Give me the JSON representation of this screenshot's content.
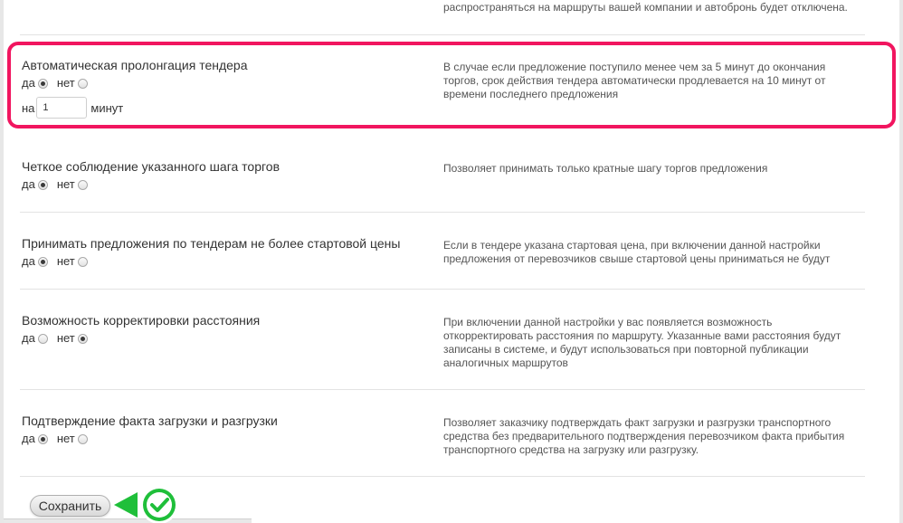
{
  "top_note": "распространяться на маршруты вашей компании и автобронь будет отключена.",
  "radio_labels": {
    "yes": "да",
    "no": "нет"
  },
  "settings": [
    {
      "title": "Автоматическая пролонгация тендера",
      "description": "В случае если предложение поступило менее чем за 5 минут до окончания торгов, срок действия тендера автоматически продлевается на 10 минут от времени последнего предложения",
      "selected": "да",
      "extend": {
        "prefix": "на",
        "value": "1",
        "suffix": "минут"
      }
    },
    {
      "title": "Четкое соблюдение указанного шага торгов",
      "description": "Позволяет принимать только кратные шагу торгов предложения",
      "selected": "да"
    },
    {
      "title": "Принимать предложения по тендерам не более стартовой цены",
      "description": "Если в тендере указана стартовая цена, при включении данной настройки предложения от перевозчиков свыше стартовой цены приниматься не будут",
      "selected": "да"
    },
    {
      "title": "Возможность корректировки расстояния",
      "description": "При включении данной настройки у вас появляется возможность откорректировать расстояния по маршруту. Указанные вами расстояния будут записаны в системе, и будут использоваться при повторной публикации аналогичных маршрутов",
      "selected": "нет"
    },
    {
      "title": "Подтверждение факта загрузки и разгрузки",
      "description": "Позволяет заказчику подтверждать факт загрузки и разгрузки транспортного средства без предварительного подтверждения перевозчиком факта прибытия транспортного средства на загрузку или разгрузку.",
      "selected": "да"
    }
  ],
  "save_label": "Сохранить",
  "colors": {
    "highlight": "#f1155f",
    "badge_green": "#1fbf3a",
    "badge_dark_green": "#0e8c25"
  },
  "icons": {
    "save_confirm": "check-circle-icon"
  }
}
